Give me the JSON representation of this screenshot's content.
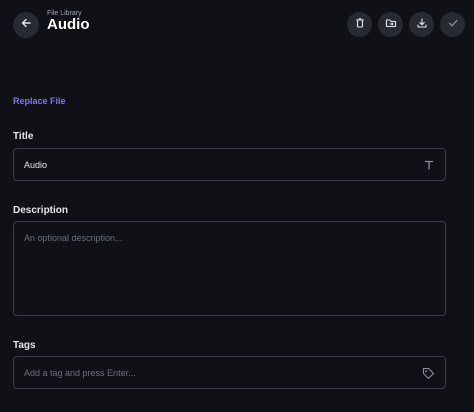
{
  "header": {
    "breadcrumb": "File Library",
    "title": "Audio",
    "back_icon": "arrow-left-icon",
    "actions": [
      {
        "name": "delete",
        "icon": "trash-icon"
      },
      {
        "name": "move-to-folder",
        "icon": "folder-move-icon"
      },
      {
        "name": "download",
        "icon": "download-icon"
      },
      {
        "name": "save",
        "icon": "check-icon"
      }
    ]
  },
  "form": {
    "replace_file_label": "Replace File",
    "title_label": "Title",
    "title_value": "Audio",
    "description_label": "Description",
    "description_placeholder": "An optional description...",
    "tags_label": "Tags",
    "tags_placeholder": "Add a tag and press Enter..."
  },
  "colors": {
    "background": "#0f1117",
    "accent": "#7f73f2",
    "button_bg": "#272a33",
    "border": "#3a3e48"
  }
}
